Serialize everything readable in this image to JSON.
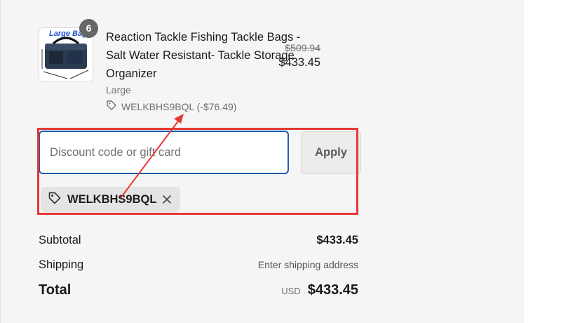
{
  "product": {
    "title": "Reaction Tackle Fishing Tackle Bags - Salt Water Resistant- Tackle Storage Organizer",
    "image_label": "Large Bag",
    "quantity": "6",
    "variant": "Large",
    "discount": "WELKBHS9BQL (-$76.49)",
    "price_original": "$509.94",
    "price_current": "$433.45"
  },
  "discount_form": {
    "placeholder": "Discount code or gift card",
    "value": "",
    "apply_label": "Apply",
    "applied_code": "WELKBHS9BQL"
  },
  "summary": {
    "subtotal_label": "Subtotal",
    "subtotal_value": "$433.45",
    "shipping_label": "Shipping",
    "shipping_value": "Enter shipping address",
    "total_label": "Total",
    "currency": "USD",
    "total_value": "$433.45"
  },
  "colors": {
    "annotation": "#e53935",
    "input_focus": "#1f5fa8",
    "panel_bg": "#f5f5f5"
  },
  "icons": {
    "discount_tag": "tag-icon",
    "remove_code": "close-icon"
  }
}
